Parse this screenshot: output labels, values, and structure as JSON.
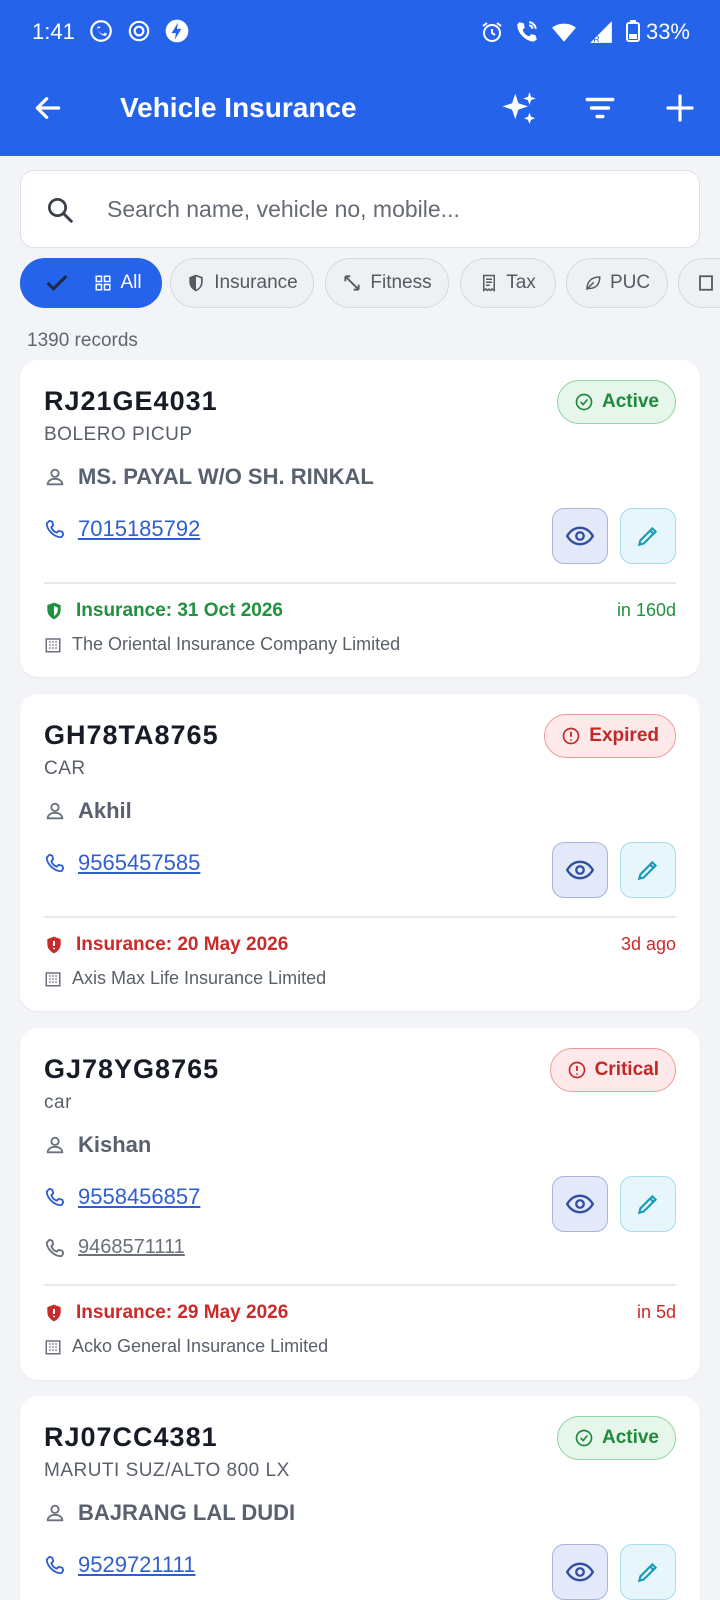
{
  "status_bar": {
    "time": "1:41",
    "battery": "33%"
  },
  "appbar": {
    "title": "Vehicle Insurance"
  },
  "search": {
    "placeholder": "Search name, vehicle no, mobile..."
  },
  "chips": [
    {
      "label": "All",
      "active": true
    },
    {
      "label": "Insurance"
    },
    {
      "label": "Fitness"
    },
    {
      "label": "Tax"
    },
    {
      "label": "PUC"
    }
  ],
  "records_count": "1390 records",
  "colors": {
    "primary": "#2563eb",
    "active": "#1f8a3c",
    "danger": "#c22828",
    "link": "#2f5fcf"
  },
  "records": [
    {
      "vehicle_no": "RJ21GE4031",
      "model": "BOLERO PICUP",
      "status": "Active",
      "owner": "MS. PAYAL W/O SH. RINKAL",
      "phone": "7015185792",
      "insurance": "Insurance: 31 Oct 2026",
      "due": "in 160d",
      "company": "The Oriental Insurance Company Limited"
    },
    {
      "vehicle_no": "GH78TA8765",
      "model": "CAR",
      "status": "Expired",
      "owner": "Akhil",
      "phone": "9565457585",
      "insurance": "Insurance: 20 May 2026",
      "due": "3d ago",
      "company": "Axis Max Life Insurance Limited"
    },
    {
      "vehicle_no": "GJ78YG8765",
      "model": "car",
      "status": "Critical",
      "owner": "Kishan",
      "phone": "9558456857",
      "phone_alt": "9468571111",
      "insurance": "Insurance: 29 May 2026",
      "due": "in 5d",
      "company": "Acko General Insurance Limited"
    },
    {
      "vehicle_no": "RJ07CC4381",
      "model": "MARUTI SUZ/ALTO 800 LX",
      "status": "Active",
      "owner": "BAJRANG LAL DUDI",
      "phone": "9529721111"
    }
  ]
}
